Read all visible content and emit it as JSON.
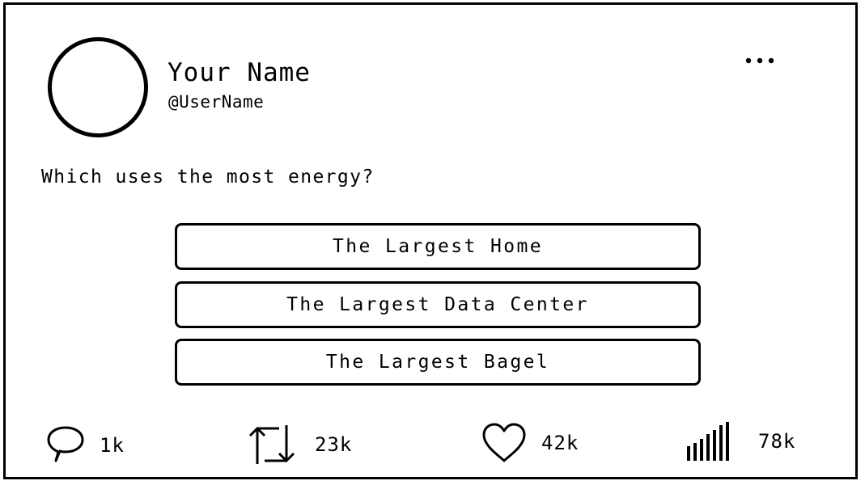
{
  "post": {
    "author_name": "Your Name",
    "author_handle": "@UserName",
    "question": "Which uses the most energy?"
  },
  "poll": {
    "options": [
      {
        "label": "The Largest Home"
      },
      {
        "label": "The Largest Data Center"
      },
      {
        "label": "The Largest Bagel"
      }
    ]
  },
  "actions": {
    "replies": "1k",
    "reposts": "23k",
    "likes": "42k",
    "views": "78k"
  },
  "icons": {
    "more": "more-horizontal-icon",
    "reply": "speech-bubble-icon",
    "repost": "repost-arrows-icon",
    "like": "heart-icon",
    "views": "bar-chart-icon"
  }
}
